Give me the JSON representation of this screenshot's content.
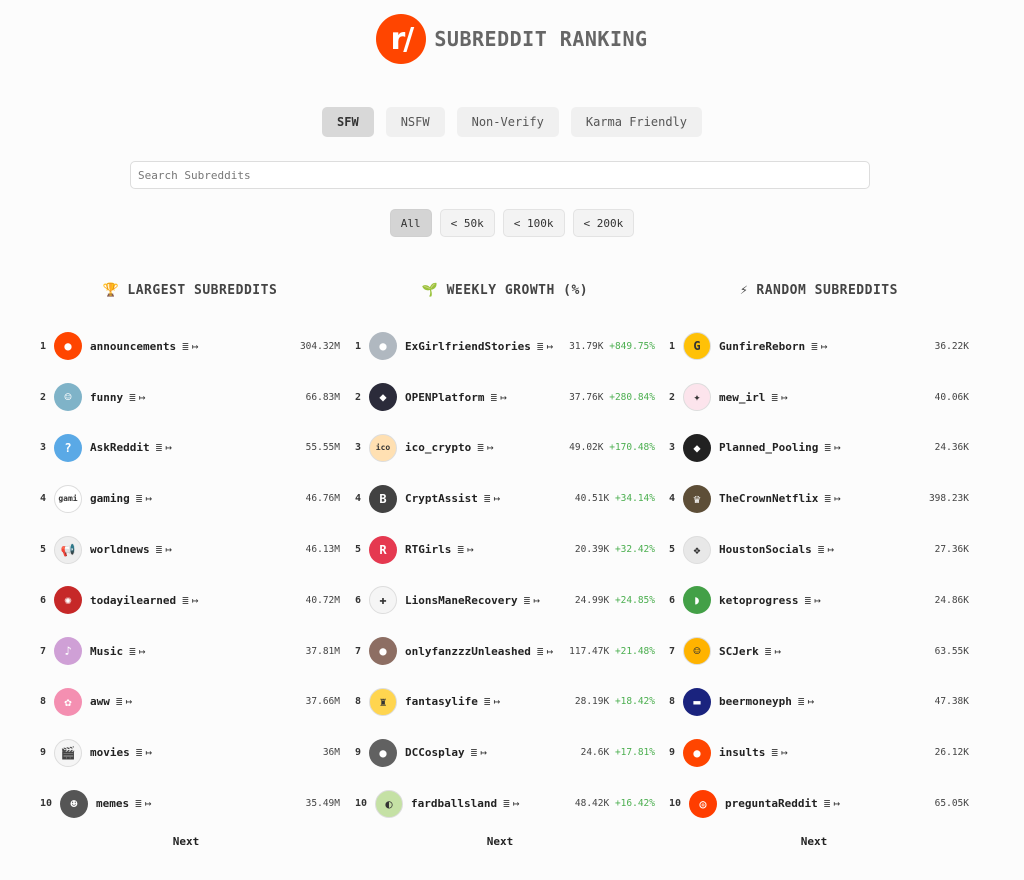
{
  "header": {
    "logo_text": "r/",
    "title": "SUBREDDIT RANKING",
    "logo_color": "#ff4500"
  },
  "tabs": [
    {
      "label": "SFW",
      "active": true
    },
    {
      "label": "NSFW",
      "active": false
    },
    {
      "label": "Non-Verify",
      "active": false
    },
    {
      "label": "Karma Friendly",
      "active": false
    }
  ],
  "search": {
    "placeholder": "Search Subreddits",
    "value": ""
  },
  "filters": [
    {
      "label": "All",
      "active": true
    },
    {
      "label": "< 50k",
      "active": false
    },
    {
      "label": "< 100k",
      "active": false
    },
    {
      "label": "< 200k",
      "active": false
    }
  ],
  "actions": {
    "list_icon": "list-icon",
    "list_glyph": "≣",
    "open_icon": "open-link-icon",
    "open_glyph": "↦"
  },
  "columns": [
    {
      "title": "LARGEST SUBREDDITS",
      "icon": "trophy-icon",
      "icon_glyph": "🏆",
      "next_label": "Next",
      "rows": [
        {
          "rank": "1",
          "name": "announcements",
          "members": "304.32M",
          "avatar_color": "#ff4500",
          "avatar_glyph": "●"
        },
        {
          "rank": "2",
          "name": "funny",
          "members": "66.83M",
          "avatar_color": "#7fb3c8",
          "avatar_glyph": "☺"
        },
        {
          "rank": "3",
          "name": "AskReddit",
          "members": "55.55M",
          "avatar_color": "#5aa9e6",
          "avatar_glyph": "?"
        },
        {
          "rank": "4",
          "name": "gaming",
          "members": "46.76M",
          "avatar_color": "#ffffff",
          "avatar_glyph": "gami"
        },
        {
          "rank": "5",
          "name": "worldnews",
          "members": "46.13M",
          "avatar_color": "#eeeeee",
          "avatar_glyph": "📢"
        },
        {
          "rank": "6",
          "name": "todayilearned",
          "members": "40.72M",
          "avatar_color": "#c62828",
          "avatar_glyph": "✺"
        },
        {
          "rank": "7",
          "name": "Music",
          "members": "37.81M",
          "avatar_color": "#cfa0d6",
          "avatar_glyph": "♪"
        },
        {
          "rank": "8",
          "name": "aww",
          "members": "37.66M",
          "avatar_color": "#f48fb1",
          "avatar_glyph": "✿"
        },
        {
          "rank": "9",
          "name": "movies",
          "members": "36M",
          "avatar_color": "#f5f5f5",
          "avatar_glyph": "🎬"
        },
        {
          "rank": "10",
          "name": "memes",
          "members": "35.49M",
          "avatar_color": "#555555",
          "avatar_glyph": "☻"
        }
      ]
    },
    {
      "title": "WEEKLY GROWTH (%)",
      "icon": "sprout-icon",
      "icon_glyph": "🌱",
      "next_label": "Next",
      "rows": [
        {
          "rank": "1",
          "name": "ExGirlfriendStories",
          "members": "31.79K",
          "growth": "+849.75%",
          "avatar_color": "#b0b8c0",
          "avatar_glyph": "●"
        },
        {
          "rank": "2",
          "name": "OPENPlatform",
          "members": "37.76K",
          "growth": "+280.84%",
          "avatar_color": "#2b2b3a",
          "avatar_glyph": "◆"
        },
        {
          "rank": "3",
          "name": "ico_crypto",
          "members": "49.02K",
          "growth": "+170.48%",
          "avatar_color": "#ffe0b2",
          "avatar_glyph": "ico"
        },
        {
          "rank": "4",
          "name": "CryptAssist",
          "members": "40.51K",
          "growth": "+34.14%",
          "avatar_color": "#424242",
          "avatar_glyph": "B"
        },
        {
          "rank": "5",
          "name": "RTGirls",
          "members": "20.39K",
          "growth": "+32.42%",
          "avatar_color": "#e53950",
          "avatar_glyph": "R"
        },
        {
          "rank": "6",
          "name": "LionsManeRecovery",
          "members": "24.99K",
          "growth": "+24.85%",
          "avatar_color": "#f5f5f5",
          "avatar_glyph": "✚"
        },
        {
          "rank": "7",
          "name": "onlyfanzzzUnleashed",
          "members": "117.47K",
          "growth": "+21.48%",
          "avatar_color": "#8d6e63",
          "avatar_glyph": "●"
        },
        {
          "rank": "8",
          "name": "fantasylife",
          "members": "28.19K",
          "growth": "+18.42%",
          "avatar_color": "#ffd54f",
          "avatar_glyph": "♜"
        },
        {
          "rank": "9",
          "name": "DCCosplay",
          "members": "24.6K",
          "growth": "+17.81%",
          "avatar_color": "#616161",
          "avatar_glyph": "●"
        },
        {
          "rank": "10",
          "name": "fardballsland",
          "members": "48.42K",
          "growth": "+16.42%",
          "avatar_color": "#c5e1a5",
          "avatar_glyph": "◐"
        }
      ]
    },
    {
      "title": "RANDOM SUBREDDITS",
      "icon": "lightning-icon",
      "icon_glyph": "⚡",
      "next_label": "Next",
      "rows": [
        {
          "rank": "1",
          "name": "GunfireReborn",
          "members": "36.22K",
          "avatar_color": "#ffc107",
          "avatar_glyph": "G"
        },
        {
          "rank": "2",
          "name": "mew_irl",
          "members": "40.06K",
          "avatar_color": "#fce4ec",
          "avatar_glyph": "✦"
        },
        {
          "rank": "3",
          "name": "Planned_Pooling",
          "members": "24.36K",
          "avatar_color": "#212121",
          "avatar_glyph": "◆"
        },
        {
          "rank": "4",
          "name": "TheCrownNetflix",
          "members": "398.23K",
          "avatar_color": "#5d4e37",
          "avatar_glyph": "♛"
        },
        {
          "rank": "5",
          "name": "HoustonSocials",
          "members": "27.36K",
          "avatar_color": "#e8e8e8",
          "avatar_glyph": "❖"
        },
        {
          "rank": "6",
          "name": "ketoprogress",
          "members": "24.86K",
          "avatar_color": "#43a047",
          "avatar_glyph": "◗"
        },
        {
          "rank": "7",
          "name": "SCJerk",
          "members": "63.55K",
          "avatar_color": "#ffb300",
          "avatar_glyph": "☺"
        },
        {
          "rank": "8",
          "name": "beermoneyph",
          "members": "47.38K",
          "avatar_color": "#1a237e",
          "avatar_glyph": "▬"
        },
        {
          "rank": "9",
          "name": "insults",
          "members": "26.12K",
          "avatar_color": "#ff4500",
          "avatar_glyph": "●"
        },
        {
          "rank": "10",
          "name": "preguntaReddit",
          "members": "65.05K",
          "avatar_color": "#ff3d00",
          "avatar_glyph": "◎"
        }
      ]
    }
  ]
}
